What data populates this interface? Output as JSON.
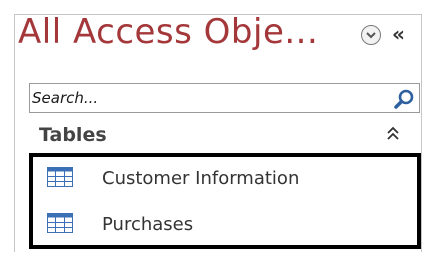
{
  "nav_pane": {
    "title": "All Access Obje...",
    "search": {
      "placeholder": "Search...",
      "value": ""
    },
    "group": {
      "label": "Tables",
      "items": [
        {
          "label": "Customer Information",
          "icon": "table-icon"
        },
        {
          "label": "Purchases",
          "icon": "table-icon"
        }
      ]
    },
    "icons": {
      "menu": "chevron-down-circle-icon",
      "collapse": "double-chevron-left-icon",
      "search": "magnifier-icon",
      "group_toggle": "double-chevron-up-icon"
    },
    "colors": {
      "title": "#a4373a",
      "table_icon": "#3b6fb6",
      "highlight_border": "#000000"
    }
  }
}
